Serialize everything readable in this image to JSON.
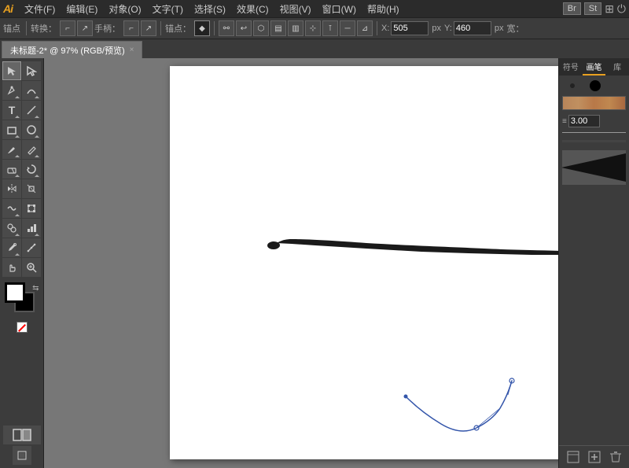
{
  "app": {
    "logo": "Ai",
    "name": "Adobe Illustrator"
  },
  "menubar": {
    "items": [
      "文件(F)",
      "编辑(E)",
      "对象(O)",
      "文字(T)",
      "选择(S)",
      "效果(C)",
      "视图(V)",
      "窗口(W)",
      "帮助(H)"
    ]
  },
  "toolbar": {
    "anchor_label": "锚点",
    "transform_label": "转换：",
    "handle_label": "手柄：",
    "anchor2_label": "锚点：",
    "x_label": "X:",
    "x_value": "505",
    "y_label": "Y:",
    "y_value": "460",
    "width_label": "宽："
  },
  "tab": {
    "title": "未标题-2* @ 97% (RGB/预览)",
    "close": "×"
  },
  "right_panel": {
    "tabs": [
      "符号",
      "画笔",
      "库"
    ],
    "active_tab": "画笔",
    "brush_size": "3.00"
  },
  "canvas": {
    "background": "#ffffff"
  }
}
